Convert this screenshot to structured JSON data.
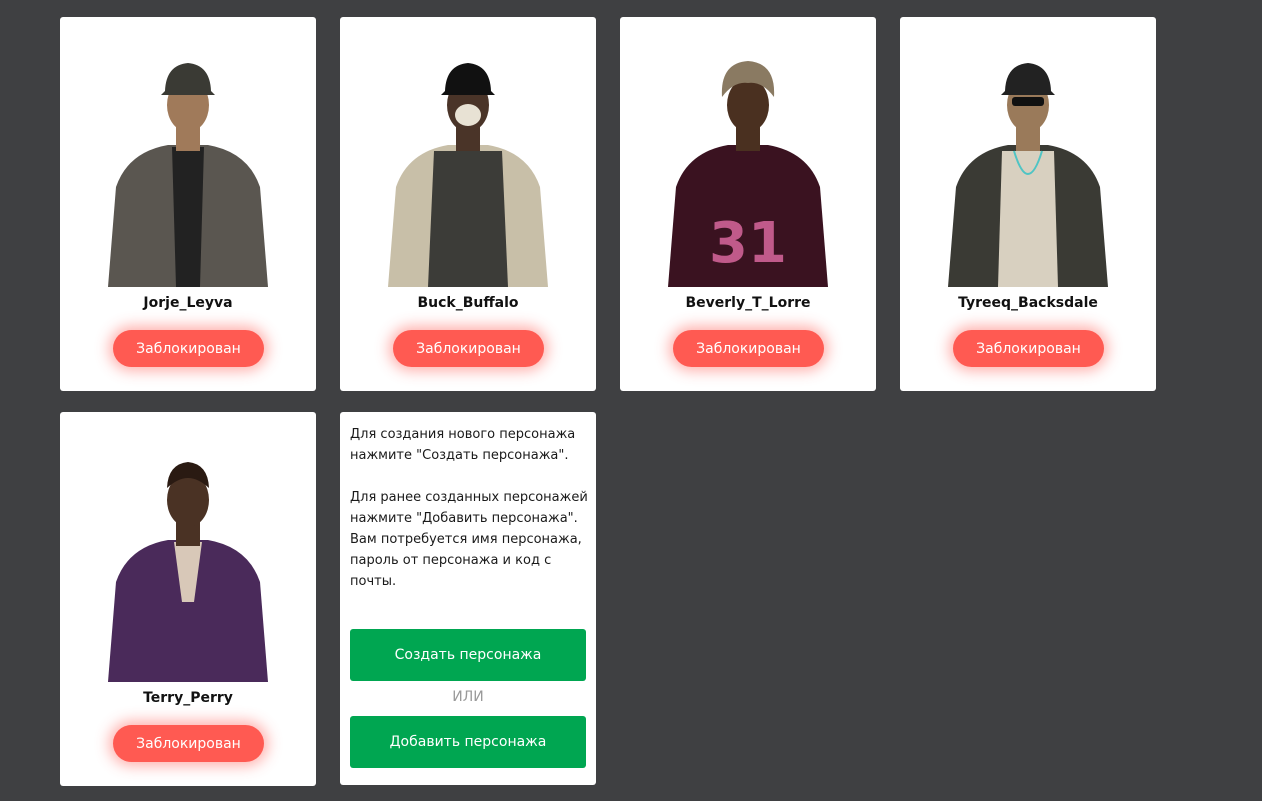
{
  "characters": [
    {
      "name": "Jorje_Leyva",
      "status": "Заблокирован",
      "shirt": "#5a5650",
      "skin": "#a07a5a",
      "hat": "#3a3a34",
      "inner": "#222222"
    },
    {
      "name": "Buck_Buffalo",
      "status": "Заблокирован",
      "shirt": "#c8bfa8",
      "skin": "#4a3428",
      "hat": "#111111",
      "inner": "#3c3c38"
    },
    {
      "name": "Beverly_T_Lorre",
      "status": "Заблокирован",
      "shirt": "#3a1220",
      "skin": "#4a3020",
      "hat": "#8a7a62",
      "inner": "#c05a8a"
    },
    {
      "name": "Tyreeq_Backsdale",
      "status": "Заблокирован",
      "shirt": "#3a3a34",
      "skin": "#9a7a5a",
      "hat": "#222222",
      "inner": "#d8d0c0"
    },
    {
      "name": "Terry_Perry",
      "status": "Заблокирован",
      "shirt": "#4a2a5a",
      "skin": "#4a3224",
      "hat": "#2a1a12",
      "inner": "#d8c8b8"
    }
  ],
  "info": {
    "paragraph1": "Для создания нового персонажа нажмите \"Создать персонажа\".",
    "paragraph2": "Для ранее созданных персонажей нажмите \"Добавить персонажа\". Вам потребуется имя персонажа, пароль от персонажа и код с почты.",
    "create_label": "Создать персонажа",
    "or_label": "ИЛИ",
    "add_label": "Добавить персонажа"
  },
  "colors": {
    "background": "#3f4042",
    "blocked": "#ff5a52",
    "action": "#00a651"
  }
}
